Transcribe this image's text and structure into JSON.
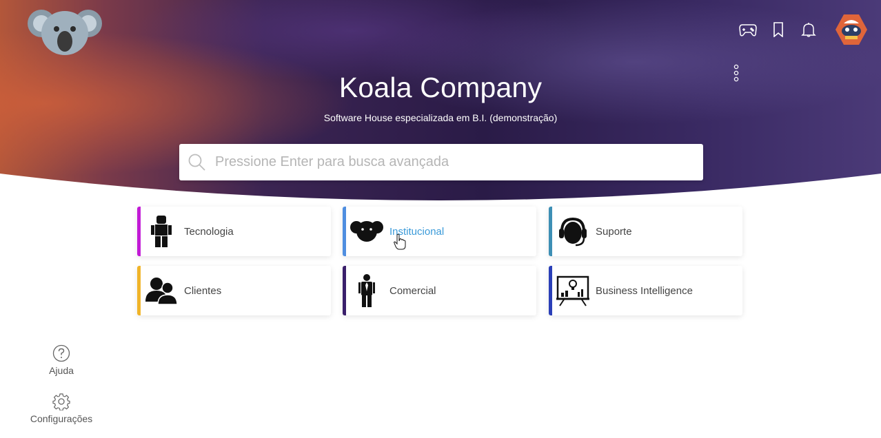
{
  "app": {
    "title": "Koala Company",
    "subtitle": "Software House especializada em B.I. (demonstração)"
  },
  "search": {
    "placeholder": "Pressione Enter para busca avançada",
    "value": ""
  },
  "header_icons": [
    "gamepad-icon",
    "bookmark-icon",
    "bell-icon",
    "avatar"
  ],
  "colors": {
    "hero_dark": "#2a1a4e",
    "hero_warm": "#c45a3a",
    "active_link": "#3a9ad9"
  },
  "categories": [
    {
      "label": "Tecnologia",
      "icon": "robot-figure-icon",
      "accent": "#c21bd6"
    },
    {
      "label": "Institucional",
      "icon": "koala-icon",
      "accent": "#4f8ee0",
      "active": true
    },
    {
      "label": "Suporte",
      "icon": "headset-icon",
      "accent": "#3d8fb5"
    },
    {
      "label": "Clientes",
      "icon": "users-icon",
      "accent": "#f0b429"
    },
    {
      "label": "Comercial",
      "icon": "businessman-icon",
      "accent": "#3a1f6b"
    },
    {
      "label": "Business Intelligence",
      "icon": "bi-dashboard-icon",
      "accent": "#2a3fb8"
    }
  ],
  "side_nav": [
    {
      "label": "Ajuda",
      "icon": "help-icon"
    },
    {
      "label": "Configurações",
      "icon": "gear-icon"
    }
  ]
}
